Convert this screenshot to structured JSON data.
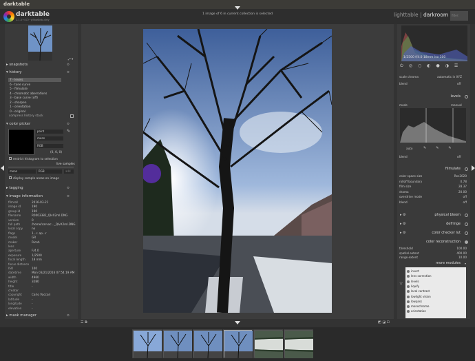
{
  "window": {
    "title": "darktable"
  },
  "app": {
    "name": "darktable",
    "version": "2.1.0+472~g9ba6bfb-dirty"
  },
  "header": {
    "collection_info": "1 image of 6 in current collection is selected",
    "views": {
      "lighttable": "lighttable",
      "separator": "|",
      "darkroom": "darkroom",
      "separator2": "|"
    },
    "filter_label": "filter:"
  },
  "left": {
    "snapshots": {
      "label": "snapshots"
    },
    "history": {
      "label": "history",
      "items": [
        "7 - levels",
        "6 - tone curve",
        "5 - filmulate",
        "4 - chromatic aberrations",
        "3 - base curve (off)",
        "2 - sharpen",
        "1 - orientation",
        "0 - original"
      ],
      "compress": "compress history stack"
    },
    "color_picker": {
      "label": "color picker",
      "mode": "point",
      "stat": "mean",
      "space": "RGB",
      "values": "(0, 0, 0)",
      "restrict": "restrict histogram to selection",
      "live_samples": "live samples",
      "sample_stat": "mean",
      "sample_space": "RGB",
      "add": "add",
      "display": "display sample areas on image"
    },
    "tagging": {
      "label": "tagging"
    },
    "image_info": {
      "label": "image information",
      "rows": [
        [
          "filmroll",
          "2016-03-21"
        ],
        [
          "image id",
          "190"
        ],
        [
          "group id",
          "190"
        ],
        [
          "filename",
          "R0003382_QIvX2ml.DNG"
        ],
        [
          "version",
          "0"
        ],
        [
          "full path",
          "/home/carvac..._QIvX2ml.DNG"
        ],
        [
          "local copy",
          "no"
        ],
        [
          "flags",
          "1...r..ap...r"
        ],
        [
          "model",
          "GR"
        ],
        [
          "maker",
          "Ricoh"
        ],
        [
          "lens",
          ""
        ],
        [
          "aperture",
          "F/4.0"
        ],
        [
          "exposure",
          "1/2500"
        ],
        [
          "focal length",
          "18 mm"
        ],
        [
          "focus distance",
          ""
        ],
        [
          "ISO",
          "100"
        ],
        [
          "datetime",
          "Mon 03/21/2016 07:54:19 AM"
        ],
        [
          "width",
          "4960"
        ],
        [
          "height",
          "3280"
        ],
        [
          "title",
          "-"
        ],
        [
          "creator",
          ""
        ],
        [
          "copyright",
          "Carlo Vaccari"
        ],
        [
          "latitude",
          "-"
        ],
        [
          "longitude",
          "-"
        ],
        [
          "elevation",
          "-"
        ]
      ]
    },
    "mask_manager": {
      "label": "mask manager"
    }
  },
  "right": {
    "histogram_info": "1/2500 f/4.0 18mm iso 100",
    "top_rows": [
      [
        "scale chroma",
        "automatic in XYZ"
      ],
      [
        "blend",
        "off"
      ]
    ],
    "levels": {
      "label": "levels",
      "mode_label": "mode",
      "mode_value": "manual",
      "auto": "auto",
      "blend": "blend",
      "blend_value": "off"
    },
    "filmulate": {
      "label": "filmulate",
      "rows": [
        [
          "color space size",
          "Rec2020"
        ],
        [
          "rolloff boundary",
          "0.78"
        ],
        [
          "film size",
          "28.37"
        ],
        [
          "drama",
          "20.00"
        ],
        [
          "overdrive mode",
          "off"
        ],
        [
          "blend",
          "off"
        ]
      ]
    },
    "modules": [
      "physical bloom",
      "defringe",
      "color checker lut"
    ],
    "color_reconstruction": {
      "label": "color reconstruction",
      "rows": [
        [
          "threshold",
          "100.00"
        ],
        [
          "spatial extent",
          "400.00"
        ],
        [
          "range extent",
          "10.00"
        ]
      ]
    },
    "more_modules": {
      "label": "more modules",
      "items": [
        "invert",
        "lens correction",
        "levels",
        "liquify",
        "local contrast",
        "lowlight vision",
        "lowpass",
        "monochrome",
        "orientation"
      ]
    }
  },
  "filmstrip": {
    "selected_index": 3
  },
  "colors": {
    "accent": "#2e2e2e",
    "panel": "#3a3a3a"
  }
}
